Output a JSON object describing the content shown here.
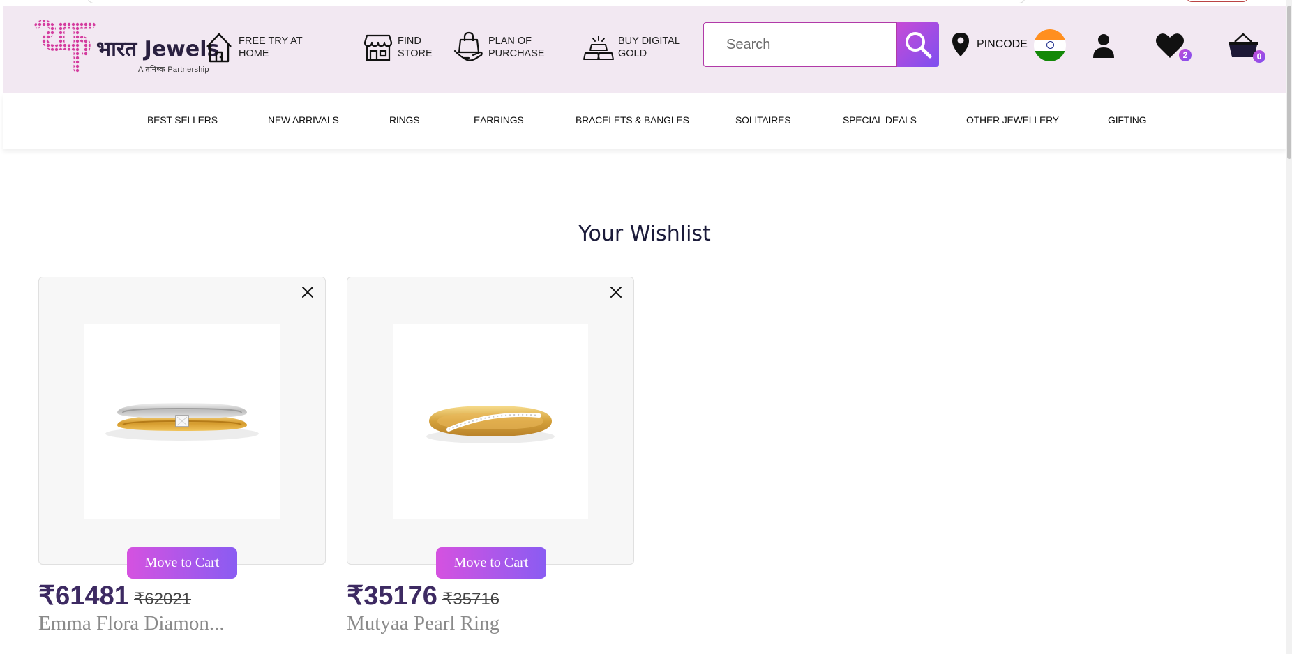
{
  "brand": {
    "name": "भारत Jewels",
    "tagline": "A तनिष्क Partnership"
  },
  "header": {
    "actions": [
      {
        "id": "try-at-home",
        "label_line1": "FREE TRY AT",
        "label_line2": "HOME",
        "icon": "house-icon"
      },
      {
        "id": "find-store",
        "label_line1": "FIND",
        "label_line2": "STORE",
        "icon": "store-icon"
      },
      {
        "id": "plan-of-purchase",
        "label_line1": "PLAN OF",
        "label_line2": "PURCHASE",
        "icon": "hand-bag-icon"
      },
      {
        "id": "digital-gold",
        "label_line1": "BUY DIGITAL",
        "label_line2": "GOLD",
        "icon": "gold-bars-icon"
      }
    ],
    "search": {
      "placeholder": "Search",
      "value": ""
    },
    "pincode_label": "PINCODE",
    "wishlist_count": "2",
    "cart_count": "0"
  },
  "nav": {
    "items": [
      "BEST SELLERS",
      "NEW ARRIVALS",
      "RINGS",
      "EARRINGS",
      "BRACELETS & BANGLES",
      "SOLITAIRES",
      "SPECIAL DEALS",
      "OTHER JEWELLERY",
      "GIFTING"
    ]
  },
  "wishlist": {
    "title": "Your Wishlist",
    "move_label": "Move to Cart",
    "items": [
      {
        "name": "Emma Flora Diamon...",
        "price": "₹61481",
        "old_price": "₹62021"
      },
      {
        "name": "Mutyaa Pearl Ring",
        "price": "₹35176",
        "old_price": "₹35716"
      }
    ]
  },
  "colors": {
    "accent_gradient_start": "#d552e0",
    "accent_gradient_end": "#8a5cf2",
    "header_bg": "#f2e8f2",
    "price_color": "#3d2a62"
  }
}
